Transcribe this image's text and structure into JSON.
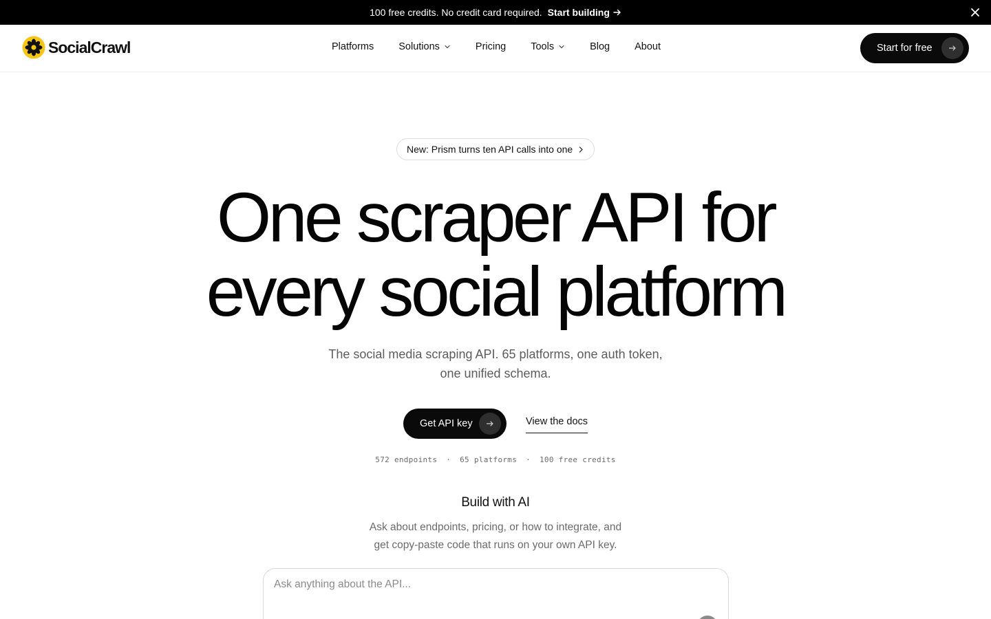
{
  "announcement": {
    "message": "100 free credits. No credit card required.",
    "cta": "Start building",
    "cta_icon": "arrow-right-icon",
    "close_icon": "close-icon"
  },
  "nav": {
    "brand": {
      "name": "SocialCrawl",
      "logo_icon": "flower-logo-icon",
      "logo_color": "#F5C518"
    },
    "items": [
      {
        "label": "Platforms",
        "dropdown": false
      },
      {
        "label": "Solutions",
        "dropdown": true
      },
      {
        "label": "Pricing",
        "dropdown": false
      },
      {
        "label": "Tools",
        "dropdown": true
      },
      {
        "label": "Blog",
        "dropdown": false
      },
      {
        "label": "About",
        "dropdown": false
      }
    ],
    "cta": {
      "label": "Start for free",
      "icon": "arrow-right-icon"
    }
  },
  "hero": {
    "pill": {
      "label": "New: Prism turns ten API calls into one",
      "icon": "chevron-right-icon"
    },
    "headline_line1": "One scraper API for",
    "headline_line2": "every social platform",
    "subtitle_line1": "The social media scraping API. 65 platforms, one auth token,",
    "subtitle_line2": "one unified schema.",
    "primary_cta": "Get API key",
    "secondary_cta": "View the docs",
    "stats": [
      "572 endpoints",
      "65 platforms",
      "100 free credits"
    ],
    "stats_separator": "·"
  },
  "build_ai": {
    "title": "Build with AI",
    "subtitle_line1": "Ask about endpoints, pricing, or how to integrate, and",
    "subtitle_line2": "get copy-paste code that runs on your own API key.",
    "input_placeholder": "Ask anything about the API...",
    "input_value": ""
  },
  "colors": {
    "primary": "#0a0a0a",
    "announcement_bg": "#000000",
    "muted_text": "#5c5c5c",
    "brand_yellow": "#F5C518"
  }
}
